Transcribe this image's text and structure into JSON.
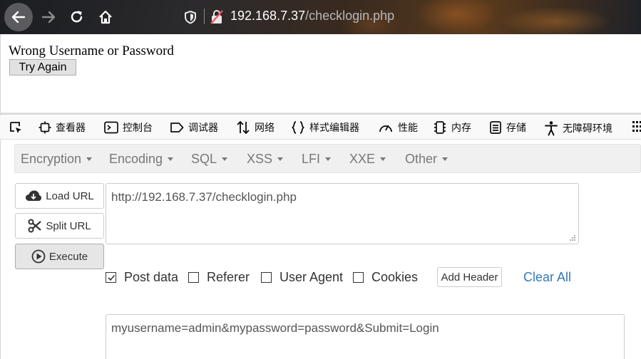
{
  "browser": {
    "url_host": "192.168.7.37",
    "url_path": "/checklogin.php",
    "icons": [
      "back-arrow-icon",
      "forward-arrow-icon",
      "reload-icon",
      "home-icon",
      "shield-icon",
      "insecure-lock-icon"
    ]
  },
  "page": {
    "message": "Wrong Username or Password",
    "button_label": "Try Again"
  },
  "devtools": {
    "tabs": [
      {
        "label": "查看器",
        "icon": "inspector-icon"
      },
      {
        "label": "控制台",
        "icon": "console-icon"
      },
      {
        "label": "调试器",
        "icon": "debugger-icon"
      },
      {
        "label": "网络",
        "icon": "network-icon"
      },
      {
        "label": "样式编辑器",
        "icon": "style-editor-icon"
      },
      {
        "label": "性能",
        "icon": "performance-icon"
      },
      {
        "label": "内存",
        "icon": "memory-icon"
      },
      {
        "label": "存储",
        "icon": "storage-icon"
      },
      {
        "label": "无障碍环境",
        "icon": "accessibility-icon"
      }
    ]
  },
  "hackbar": {
    "menu": [
      "Encryption",
      "Encoding",
      "SQL",
      "XSS",
      "LFI",
      "XXE",
      "Other"
    ],
    "load_url": "Load URL",
    "split_url": "Split URL",
    "execute": "Execute",
    "url_value": "http://192.168.7.37/checklogin.php",
    "options": {
      "post_data": {
        "label": "Post data",
        "checked": true
      },
      "referer": {
        "label": "Referer",
        "checked": false
      },
      "user_agent": {
        "label": "User Agent",
        "checked": false
      },
      "cookies": {
        "label": "Cookies",
        "checked": false
      }
    },
    "add_header": "Add Header",
    "clear_all": "Clear All",
    "post_value": "myusername=admin&mypassword=password&Submit=Login",
    "link_color": "#337ab7"
  }
}
